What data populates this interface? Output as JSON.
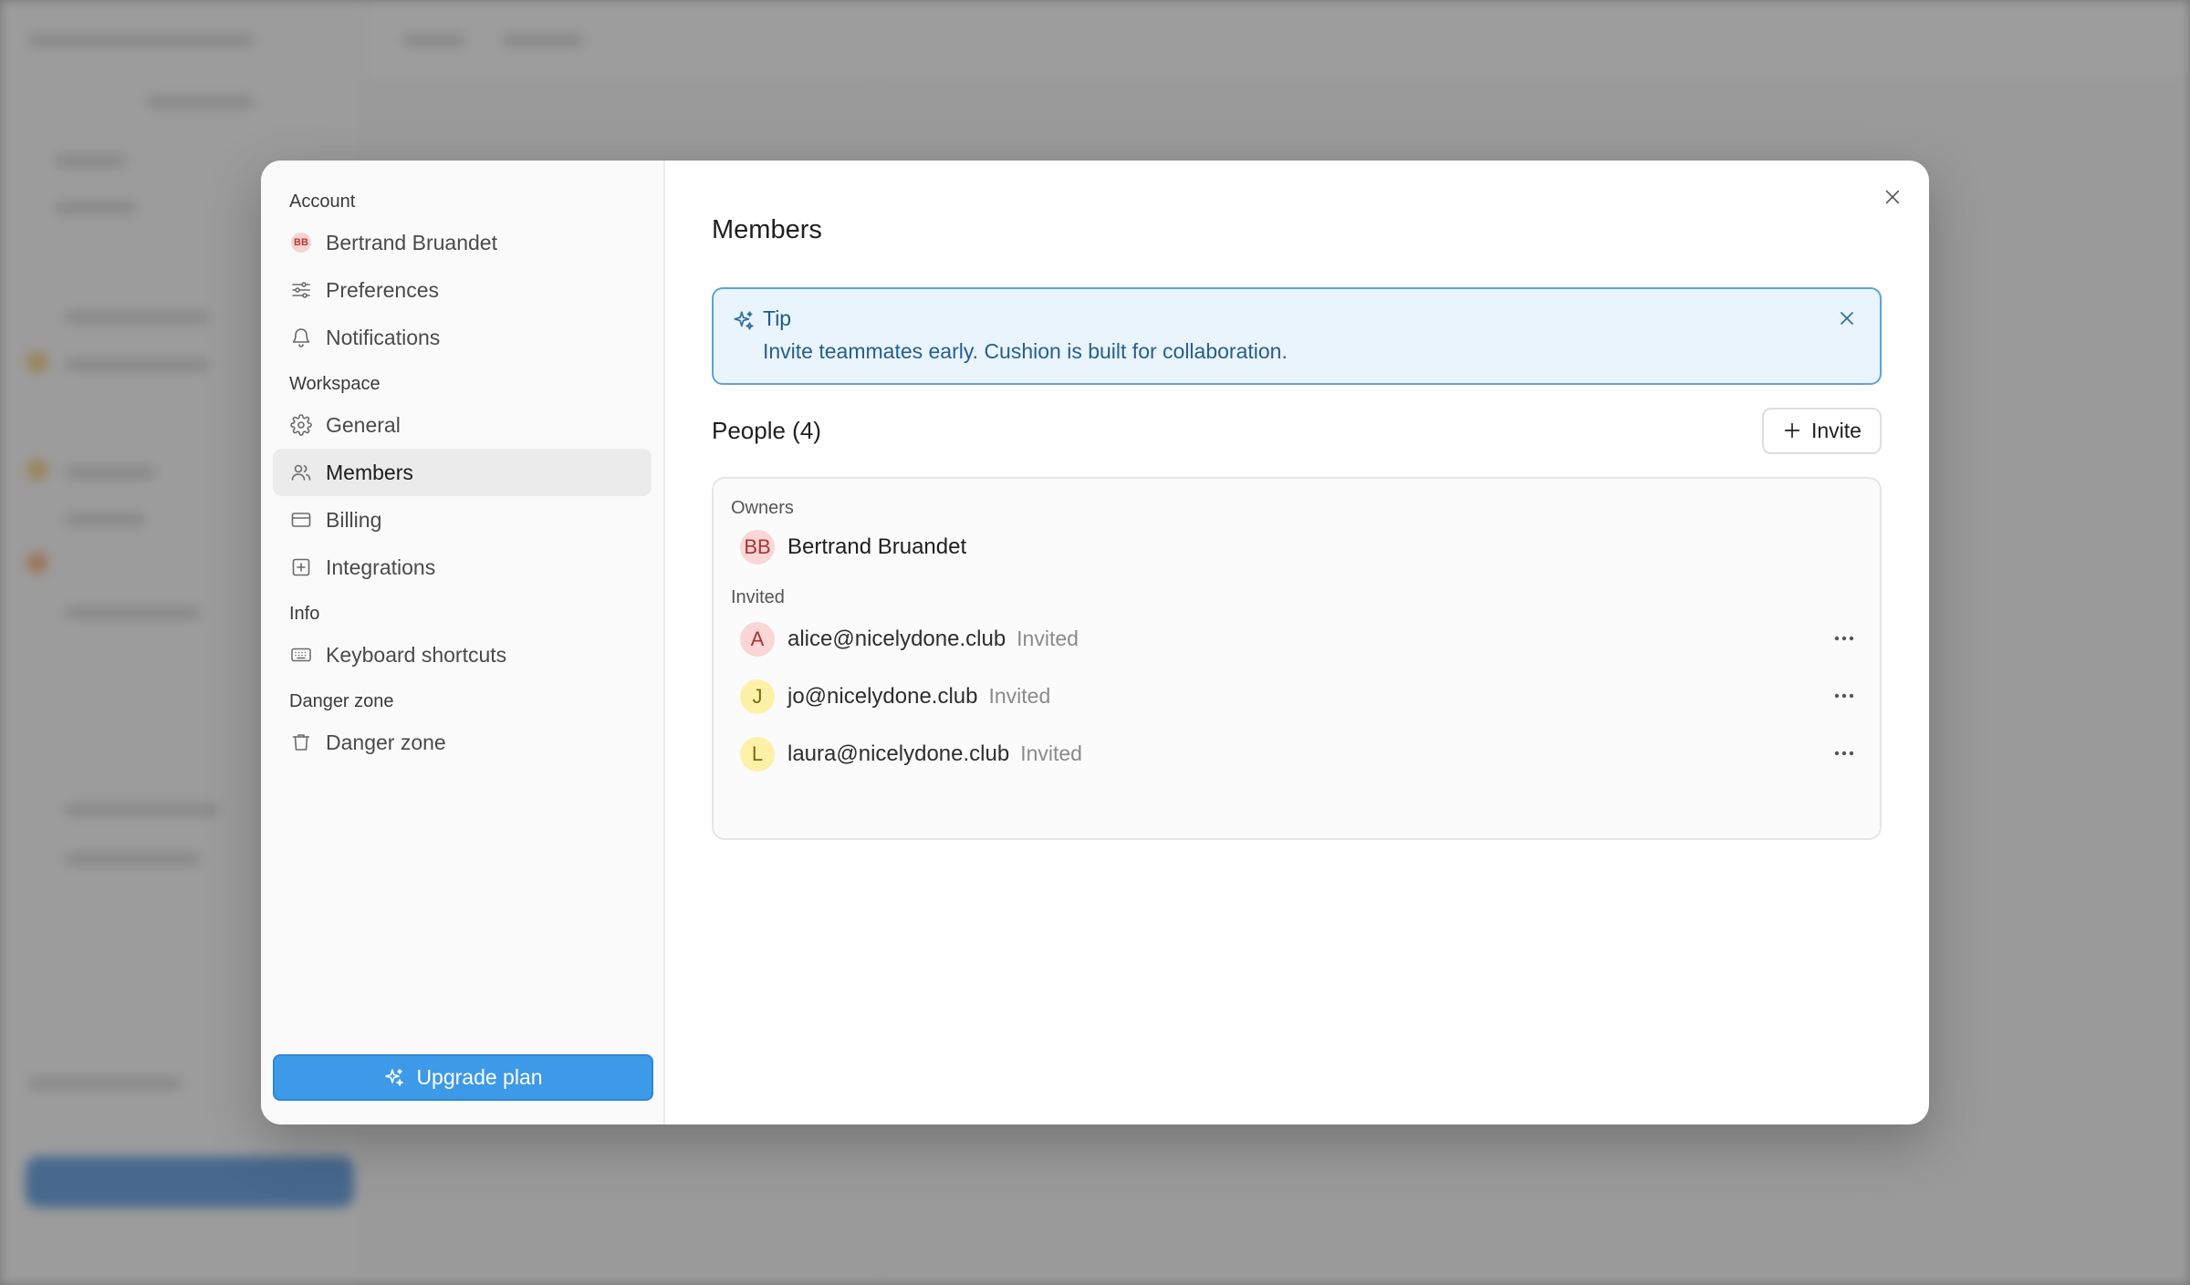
{
  "modal": {
    "sidebar": {
      "sections": [
        {
          "label": "Account"
        },
        {
          "label": "Workspace"
        },
        {
          "label": "Info"
        },
        {
          "label": "Danger zone"
        }
      ],
      "items": [
        {
          "label": "Bertrand Bruandet",
          "avatar": "BB"
        },
        {
          "label": "Preferences",
          "icon": "sliders-icon"
        },
        {
          "label": "Notifications",
          "icon": "bell-icon"
        },
        {
          "label": "General",
          "icon": "gear-icon"
        },
        {
          "label": "Members",
          "icon": "users-icon",
          "active": true
        },
        {
          "label": "Billing",
          "icon": "credit-card-icon"
        },
        {
          "label": "Integrations",
          "icon": "plus-square-icon"
        },
        {
          "label": "Keyboard shortcuts",
          "icon": "keyboard-icon"
        },
        {
          "label": "Danger zone",
          "icon": "trash-icon"
        }
      ],
      "upgrade_label": "Upgrade plan"
    },
    "main": {
      "title": "Members",
      "tip": {
        "title": "Tip",
        "text": "Invite teammates early. Cushion is built for collaboration."
      },
      "people_title": "People (4)",
      "invite_label": "Invite",
      "owners_label": "Owners",
      "owner": {
        "initials": "BB",
        "name": "Bertrand Bruandet"
      },
      "invited_label": "Invited",
      "invited": [
        {
          "initial": "A",
          "email": "alice@nicelydone.club",
          "status": "Invited"
        },
        {
          "initial": "J",
          "email": "jo@nicelydone.club",
          "status": "Invited"
        },
        {
          "initial": "L",
          "email": "laura@nicelydone.club",
          "status": "Invited"
        }
      ]
    }
  },
  "colors": {
    "accent": "#3d9ae8",
    "tip_border": "#59a4d9",
    "tip_bg": "#eaf4fc"
  }
}
